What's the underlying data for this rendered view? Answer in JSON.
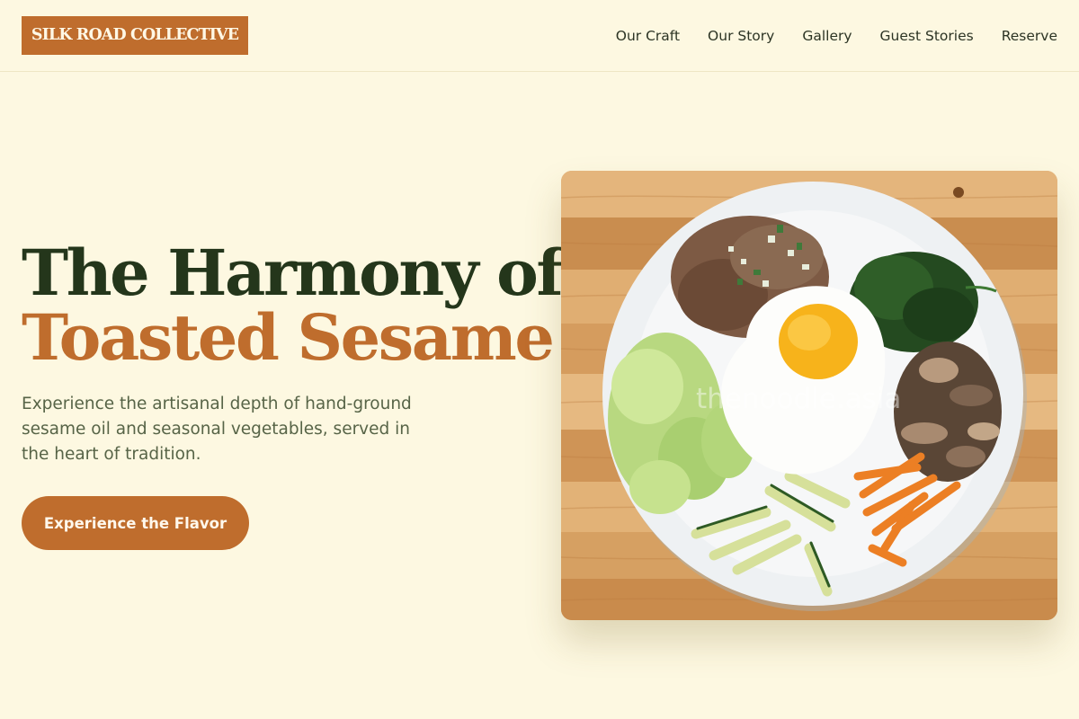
{
  "header": {
    "logo_text": "SILK ROAD COLLECTIVE",
    "nav": [
      {
        "label": "Our Craft"
      },
      {
        "label": "Our Story"
      },
      {
        "label": "Gallery"
      },
      {
        "label": "Guest Stories"
      },
      {
        "label": "Reserve"
      }
    ]
  },
  "hero": {
    "title_line1": "The Harmony of",
    "title_line2": "Toasted Sesame",
    "description": "Experience the artisanal depth of hand-ground sesame oil and seasonal vegetables, served in the heart of tradition.",
    "cta_label": "Experience the Flavor",
    "image": {
      "watermark": "thenoodle.asia"
    }
  },
  "colors": {
    "background": "#fdf8e1",
    "accent": "#bf6d2d",
    "heading": "#24361b",
    "body_text": "#576447"
  }
}
